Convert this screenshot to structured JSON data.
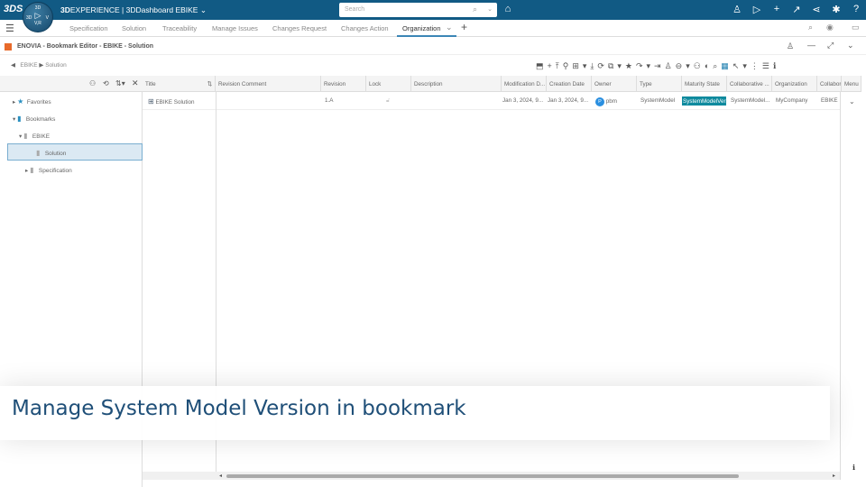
{
  "topbar": {
    "logo": "3DS",
    "compass": {
      "top": "3D",
      "left": "3D",
      "right": "V",
      "bottom": "V,R"
    },
    "brand": "3D",
    "app_rest": "EXPERIENCE | 3DDashboard",
    "tenant": "EBIKE",
    "search_placeholder": "Search"
  },
  "tabs": [
    "Specification",
    "Solution",
    "Traceability",
    "Manage Issues",
    "Changes Request",
    "Changes Action",
    "Organization"
  ],
  "active_tab": "Organization",
  "app": {
    "title": "ENOVIA - Bookmark Editor - EBIKE - Solution"
  },
  "breadcrumb": [
    "EBIKE",
    "Solution"
  ],
  "tree": [
    {
      "label": "Favorites"
    },
    {
      "label": "Bookmarks"
    },
    {
      "label": "EBIKE"
    },
    {
      "label": "Solution"
    },
    {
      "label": "Specification"
    }
  ],
  "table": {
    "columns": [
      "Title",
      "Revision Comment",
      "Revision",
      "Lock",
      "Description",
      "Modification D...",
      "Creation Date",
      "Owner",
      "Type",
      "Maturity State",
      "Collaborative ...",
      "Organization",
      "Collabor",
      "Menu"
    ],
    "rows": [
      {
        "title": "EBIKE Solution",
        "revision_comment": "",
        "revision": "1.A",
        "description": "",
        "modified": "Jan 3, 2024, 9...",
        "created": "Jan 3, 2024, 9...",
        "owner_initial": "P",
        "owner": "pbm",
        "type": "SystemModel",
        "maturity": "SystemModelVers",
        "collab": "SystemModel...",
        "organization": "MyCompany",
        "collab_space": "EBIKE"
      }
    ]
  },
  "banner": {
    "text": "Manage System Model Version in bookmark"
  },
  "colors": {
    "topbar": "#115a84",
    "maturity": "#0f8a9e",
    "owner": "#2a8fe0"
  }
}
